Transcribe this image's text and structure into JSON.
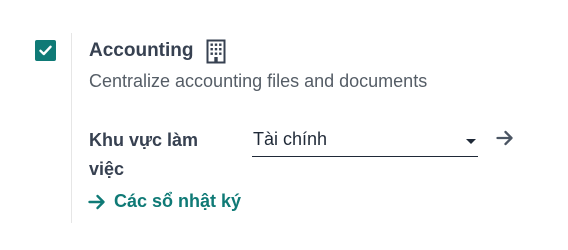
{
  "setting": {
    "checked": true,
    "title": "Accounting",
    "title_icon": "building-icon",
    "description": "Centralize accounting files and documents",
    "field": {
      "label": "Khu vực làm việc",
      "value": "Tài chính",
      "external_icon": "arrow-right-icon"
    },
    "link": {
      "icon": "arrow-right-icon",
      "label": "Các sổ nhật ký"
    }
  },
  "colors": {
    "accent": "#0f7a76",
    "text": "#374151",
    "muted": "#555d66"
  }
}
